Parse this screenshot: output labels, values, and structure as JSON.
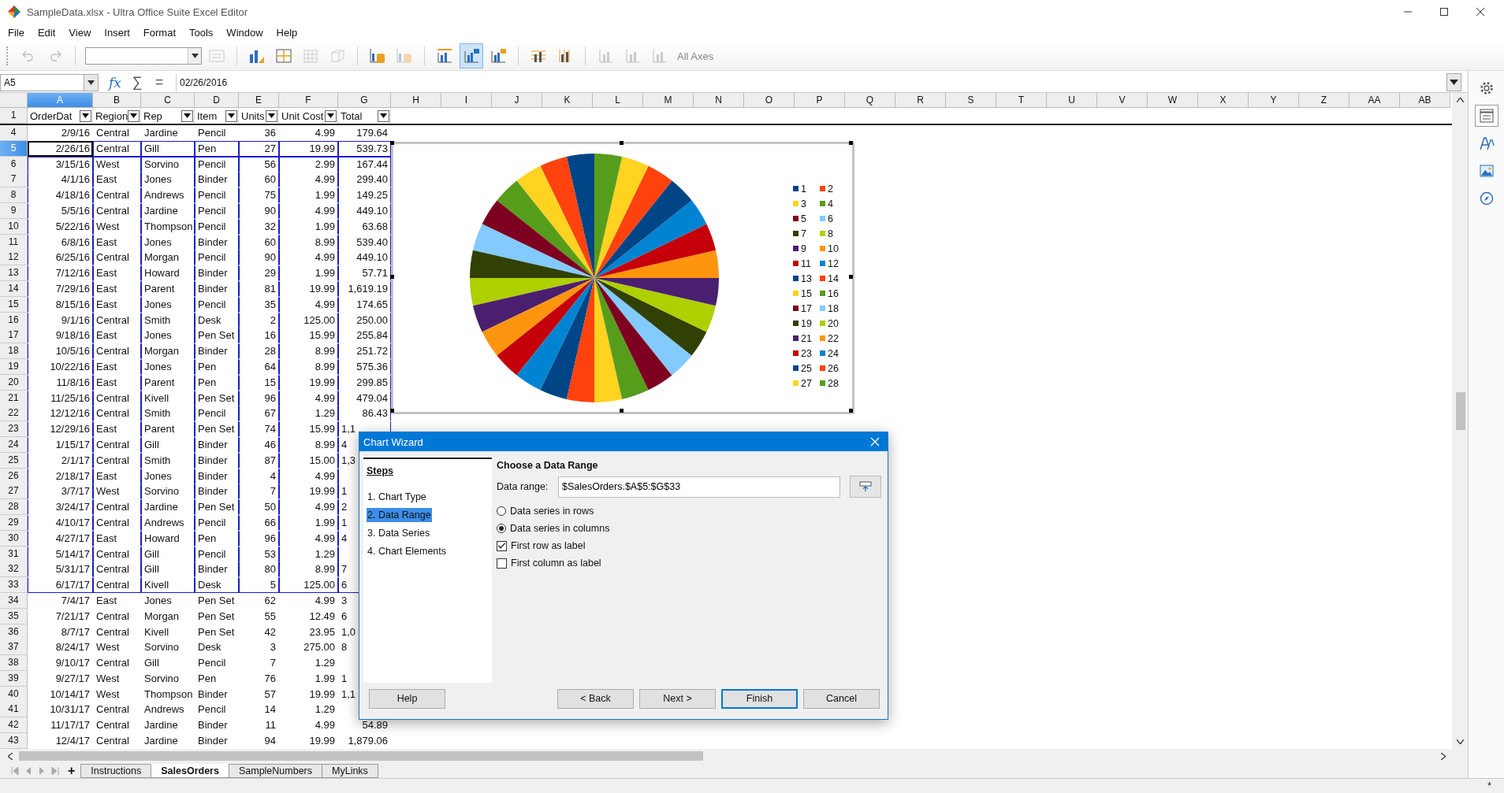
{
  "window": {
    "title": "SampleData.xlsx - Ultra Office Suite Excel Editor"
  },
  "menu": [
    "File",
    "Edit",
    "View",
    "Insert",
    "Format",
    "Tools",
    "Window",
    "Help"
  ],
  "toolbar": {
    "groups": [
      {
        "items": [
          {
            "kind": "undo",
            "disabled": true,
            "selected": false
          },
          {
            "kind": "redo",
            "disabled": true,
            "selected": false
          }
        ]
      },
      {
        "items": [
          {
            "kind": "combo",
            "disabled": false,
            "selected": false
          },
          {
            "kind": "format",
            "disabled": true,
            "selected": false
          }
        ]
      },
      {
        "items": [
          {
            "kind": "chart-type",
            "disabled": false,
            "selected": false
          },
          {
            "kind": "data-table",
            "disabled": false,
            "selected": false
          },
          {
            "kind": "grid",
            "disabled": true,
            "selected": false
          },
          {
            "kind": "cube",
            "disabled": true,
            "selected": false
          }
        ]
      },
      {
        "items": [
          {
            "kind": "data-range",
            "disabled": false,
            "selected": false
          },
          {
            "kind": "data-series",
            "disabled": true,
            "selected": false
          }
        ]
      },
      {
        "items": [
          {
            "kind": "title",
            "disabled": false,
            "selected": false
          },
          {
            "kind": "legend",
            "disabled": false,
            "selected": true
          },
          {
            "kind": "legend-toggle",
            "disabled": false,
            "selected": false
          }
        ]
      },
      {
        "items": [
          {
            "kind": "h-gridlines",
            "disabled": false,
            "selected": false
          },
          {
            "kind": "v-gridlines",
            "disabled": false,
            "selected": false
          }
        ]
      },
      {
        "items": [
          {
            "kind": "axis",
            "disabled": true,
            "selected": false
          },
          {
            "kind": "axis",
            "disabled": true,
            "selected": false
          },
          {
            "kind": "axis",
            "disabled": true,
            "selected": false
          },
          {
            "kind": "label",
            "label": "All Axes",
            "disabled": true,
            "selected": false
          }
        ]
      }
    ]
  },
  "formula_bar": {
    "name_box": "A5",
    "buttons": [
      "fx",
      "∑",
      "="
    ],
    "value": "02/26/2016"
  },
  "columns": [
    {
      "label": "A",
      "selected": true
    },
    {
      "label": "B",
      "selected": false
    },
    {
      "label": "C",
      "selected": false
    },
    {
      "label": "D",
      "selected": false
    },
    {
      "label": "E",
      "selected": false
    },
    {
      "label": "F",
      "selected": false
    },
    {
      "label": "G",
      "selected": false
    },
    {
      "label": "H",
      "selected": false
    },
    {
      "label": "I",
      "selected": false
    },
    {
      "label": "J",
      "selected": false
    },
    {
      "label": "K",
      "selected": false
    },
    {
      "label": "L",
      "selected": false
    },
    {
      "label": "M",
      "selected": false
    },
    {
      "label": "N",
      "selected": false
    },
    {
      "label": "O",
      "selected": false
    },
    {
      "label": "P",
      "selected": false
    },
    {
      "label": "Q",
      "selected": false
    },
    {
      "label": "R",
      "selected": false
    },
    {
      "label": "S",
      "selected": false
    },
    {
      "label": "T",
      "selected": false
    },
    {
      "label": "U",
      "selected": false
    },
    {
      "label": "V",
      "selected": false
    },
    {
      "label": "W",
      "selected": false
    },
    {
      "label": "X",
      "selected": false
    },
    {
      "label": "Y",
      "selected": false
    },
    {
      "label": "Z",
      "selected": false
    },
    {
      "label": "AA",
      "selected": false
    },
    {
      "label": "AB",
      "selected": false
    }
  ],
  "header_row": {
    "number": "1",
    "cells": [
      "OrderDat",
      "Region",
      "Rep",
      "Item",
      "Units",
      "Unit Cost",
      "Total"
    ]
  },
  "rows": [
    {
      "number": "4",
      "selected": false,
      "in_range": false,
      "cells": [
        "2/9/16",
        "Central",
        "Jardine",
        "Pencil",
        "36",
        "4.99",
        "179.64"
      ]
    },
    {
      "number": "5",
      "selected": true,
      "in_range": true,
      "cells": [
        "2/26/16",
        "Central",
        "Gill",
        "Pen",
        "27",
        "19.99",
        "539.73"
      ]
    },
    {
      "number": "6",
      "selected": false,
      "in_range": true,
      "cells": [
        "3/15/16",
        "West",
        "Sorvino",
        "Pencil",
        "56",
        "2.99",
        "167.44"
      ]
    },
    {
      "number": "7",
      "selected": false,
      "in_range": true,
      "cells": [
        "4/1/16",
        "East",
        "Jones",
        "Binder",
        "60",
        "4.99",
        "299.40"
      ]
    },
    {
      "number": "8",
      "selected": false,
      "in_range": true,
      "cells": [
        "4/18/16",
        "Central",
        "Andrews",
        "Pencil",
        "75",
        "1.99",
        "149.25"
      ]
    },
    {
      "number": "9",
      "selected": false,
      "in_range": true,
      "cells": [
        "5/5/16",
        "Central",
        "Jardine",
        "Pencil",
        "90",
        "4.99",
        "449.10"
      ]
    },
    {
      "number": "10",
      "selected": false,
      "in_range": true,
      "cells": [
        "5/22/16",
        "West",
        "Thompson",
        "Pencil",
        "32",
        "1.99",
        "63.68"
      ]
    },
    {
      "number": "11",
      "selected": false,
      "in_range": true,
      "cells": [
        "6/8/16",
        "East",
        "Jones",
        "Binder",
        "60",
        "8.99",
        "539.40"
      ]
    },
    {
      "number": "12",
      "selected": false,
      "in_range": true,
      "cells": [
        "6/25/16",
        "Central",
        "Morgan",
        "Pencil",
        "90",
        "4.99",
        "449.10"
      ]
    },
    {
      "number": "13",
      "selected": false,
      "in_range": true,
      "cells": [
        "7/12/16",
        "East",
        "Howard",
        "Binder",
        "29",
        "1.99",
        "57.71"
      ]
    },
    {
      "number": "14",
      "selected": false,
      "in_range": true,
      "cells": [
        "7/29/16",
        "East",
        "Parent",
        "Binder",
        "81",
        "19.99",
        "1,619.19"
      ]
    },
    {
      "number": "15",
      "selected": false,
      "in_range": true,
      "cells": [
        "8/15/16",
        "East",
        "Jones",
        "Pencil",
        "35",
        "4.99",
        "174.65"
      ]
    },
    {
      "number": "16",
      "selected": false,
      "in_range": true,
      "cells": [
        "9/1/16",
        "Central",
        "Smith",
        "Desk",
        "2",
        "125.00",
        "250.00"
      ]
    },
    {
      "number": "17",
      "selected": false,
      "in_range": true,
      "cells": [
        "9/18/16",
        "East",
        "Jones",
        "Pen Set",
        "16",
        "15.99",
        "255.84"
      ]
    },
    {
      "number": "18",
      "selected": false,
      "in_range": true,
      "cells": [
        "10/5/16",
        "Central",
        "Morgan",
        "Binder",
        "28",
        "8.99",
        "251.72"
      ]
    },
    {
      "number": "19",
      "selected": false,
      "in_range": true,
      "cells": [
        "10/22/16",
        "East",
        "Jones",
        "Pen",
        "64",
        "8.99",
        "575.36"
      ]
    },
    {
      "number": "20",
      "selected": false,
      "in_range": true,
      "cells": [
        "11/8/16",
        "East",
        "Parent",
        "Pen",
        "15",
        "19.99",
        "299.85"
      ]
    },
    {
      "number": "21",
      "selected": false,
      "in_range": true,
      "cells": [
        "11/25/16",
        "Central",
        "Kivell",
        "Pen Set",
        "96",
        "4.99",
        "479.04"
      ]
    },
    {
      "number": "22",
      "selected": false,
      "in_range": true,
      "cells": [
        "12/12/16",
        "Central",
        "Smith",
        "Pencil",
        "67",
        "1.29",
        "86.43"
      ]
    },
    {
      "number": "23",
      "selected": false,
      "in_range": true,
      "cells": [
        "12/29/16",
        "East",
        "Parent",
        "Pen Set",
        "74",
        "15.99",
        "1,1"
      ]
    },
    {
      "number": "24",
      "selected": false,
      "in_range": true,
      "cells": [
        "1/15/17",
        "Central",
        "Gill",
        "Binder",
        "46",
        "8.99",
        "4"
      ]
    },
    {
      "number": "25",
      "selected": false,
      "in_range": true,
      "cells": [
        "2/1/17",
        "Central",
        "Smith",
        "Binder",
        "87",
        "15.00",
        "1,3"
      ]
    },
    {
      "number": "26",
      "selected": false,
      "in_range": true,
      "cells": [
        "2/18/17",
        "East",
        "Jones",
        "Binder",
        "4",
        "4.99"
      ]
    },
    {
      "number": "27",
      "selected": false,
      "in_range": true,
      "cells": [
        "3/7/17",
        "West",
        "Sorvino",
        "Binder",
        "7",
        "19.99",
        "1"
      ]
    },
    {
      "number": "28",
      "selected": false,
      "in_range": true,
      "cells": [
        "3/24/17",
        "Central",
        "Jardine",
        "Pen Set",
        "50",
        "4.99",
        "2"
      ]
    },
    {
      "number": "29",
      "selected": false,
      "in_range": true,
      "cells": [
        "4/10/17",
        "Central",
        "Andrews",
        "Pencil",
        "66",
        "1.99",
        "1"
      ]
    },
    {
      "number": "30",
      "selected": false,
      "in_range": true,
      "cells": [
        "4/27/17",
        "East",
        "Howard",
        "Pen",
        "96",
        "4.99",
        "4"
      ]
    },
    {
      "number": "31",
      "selected": false,
      "in_range": true,
      "cells": [
        "5/14/17",
        "Central",
        "Gill",
        "Pencil",
        "53",
        "1.29"
      ]
    },
    {
      "number": "32",
      "selected": false,
      "in_range": true,
      "cells": [
        "5/31/17",
        "Central",
        "Gill",
        "Binder",
        "80",
        "8.99",
        "7"
      ]
    },
    {
      "number": "33",
      "selected": false,
      "in_range": true,
      "cells": [
        "6/17/17",
        "Central",
        "Kivell",
        "Desk",
        "5",
        "125.00",
        "6"
      ]
    },
    {
      "number": "34",
      "selected": false,
      "in_range": false,
      "cells": [
        "7/4/17",
        "East",
        "Jones",
        "Pen Set",
        "62",
        "4.99",
        "3"
      ]
    },
    {
      "number": "35",
      "selected": false,
      "in_range": false,
      "cells": [
        "7/21/17",
        "Central",
        "Morgan",
        "Pen Set",
        "55",
        "12.49",
        "6"
      ]
    },
    {
      "number": "36",
      "selected": false,
      "in_range": false,
      "cells": [
        "8/7/17",
        "Central",
        "Kivell",
        "Pen Set",
        "42",
        "23.95",
        "1,0"
      ]
    },
    {
      "number": "37",
      "selected": false,
      "in_range": false,
      "cells": [
        "8/24/17",
        "West",
        "Sorvino",
        "Desk",
        "3",
        "275.00",
        "8"
      ]
    },
    {
      "number": "38",
      "selected": false,
      "in_range": false,
      "cells": [
        "9/10/17",
        "Central",
        "Gill",
        "Pencil",
        "7",
        "1.29"
      ]
    },
    {
      "number": "39",
      "selected": false,
      "in_range": false,
      "cells": [
        "9/27/17",
        "West",
        "Sorvino",
        "Pen",
        "76",
        "1.99",
        "1"
      ]
    },
    {
      "number": "40",
      "selected": false,
      "in_range": false,
      "cells": [
        "10/14/17",
        "West",
        "Thompson",
        "Binder",
        "57",
        "19.99",
        "1,1"
      ]
    },
    {
      "number": "41",
      "selected": false,
      "in_range": false,
      "cells": [
        "10/31/17",
        "Central",
        "Andrews",
        "Pencil",
        "14",
        "1.29"
      ]
    },
    {
      "number": "42",
      "selected": false,
      "in_range": false,
      "cells": [
        "11/17/17",
        "Central",
        "Jardine",
        "Binder",
        "11",
        "4.99",
        "54.89"
      ]
    },
    {
      "number": "43",
      "selected": false,
      "in_range": false,
      "cells": [
        "12/4/17",
        "Central",
        "Jardine",
        "Binder",
        "94",
        "19.99",
        "1,879.06"
      ]
    }
  ],
  "chart": {
    "legend": [
      {
        "label": "1",
        "color": "#004586"
      },
      {
        "label": "2",
        "color": "#ff420e"
      },
      {
        "label": "3",
        "color": "#ffd320"
      },
      {
        "label": "4",
        "color": "#579d1c"
      },
      {
        "label": "5",
        "color": "#7e0021"
      },
      {
        "label": "6",
        "color": "#83caff"
      },
      {
        "label": "7",
        "color": "#314004"
      },
      {
        "label": "8",
        "color": "#aecf00"
      },
      {
        "label": "9",
        "color": "#4b1f6f"
      },
      {
        "label": "10",
        "color": "#ff950e"
      },
      {
        "label": "11",
        "color": "#c5000b"
      },
      {
        "label": "12",
        "color": "#0084d1"
      },
      {
        "label": "13",
        "color": "#004586"
      },
      {
        "label": "14",
        "color": "#ff420e"
      },
      {
        "label": "15",
        "color": "#ffd320"
      },
      {
        "label": "16",
        "color": "#579d1c"
      },
      {
        "label": "17",
        "color": "#7e0021"
      },
      {
        "label": "18",
        "color": "#83caff"
      },
      {
        "label": "19",
        "color": "#314004"
      },
      {
        "label": "20",
        "color": "#aecf00"
      },
      {
        "label": "21",
        "color": "#4b1f6f"
      },
      {
        "label": "22",
        "color": "#ff950e"
      },
      {
        "label": "23",
        "color": "#c5000b"
      },
      {
        "label": "24",
        "color": "#0084d1"
      },
      {
        "label": "25",
        "color": "#004586"
      },
      {
        "label": "26",
        "color": "#ff420e"
      },
      {
        "label": "27",
        "color": "#ffd320"
      },
      {
        "label": "28",
        "color": "#579d1c"
      }
    ]
  },
  "sidebar": [
    {
      "kind": "settings",
      "selected": false
    },
    {
      "kind": "properties",
      "selected": true
    },
    {
      "kind": "styles",
      "selected": false
    },
    {
      "kind": "gallery",
      "selected": false
    },
    {
      "kind": "navigator",
      "selected": false
    }
  ],
  "sheet_tabs": {
    "add": "+",
    "tabs": [
      {
        "label": "Instructions",
        "selected": false
      },
      {
        "label": "SalesOrders",
        "selected": true
      },
      {
        "label": "SampleNumbers",
        "selected": false
      },
      {
        "label": "MyLinks",
        "selected": false
      }
    ]
  },
  "status_bar": {
    "modified": "*"
  },
  "dialog": {
    "title": "Chart Wizard",
    "steps_heading": "Steps",
    "steps": [
      {
        "label": "1. Chart Type",
        "selected": false
      },
      {
        "label": "2. Data Range",
        "selected": true
      },
      {
        "label": "3. Data Series",
        "selected": false
      },
      {
        "label": "4. Chart Elements",
        "selected": false
      }
    ],
    "heading": "Choose a Data Range",
    "field_label": "Data range:",
    "field_value": "$SalesOrders.$A$5:$G$33",
    "series_in": [
      {
        "label": "Data series in rows",
        "selected": false
      },
      {
        "label": "Data series in columns",
        "selected": true
      }
    ],
    "label_options": [
      {
        "label": "First row as label",
        "checked": true
      },
      {
        "label": "First column as label",
        "checked": false
      }
    ],
    "help": "Help",
    "buttons": [
      {
        "label": "< Back",
        "default": false
      },
      {
        "label": "Next >",
        "default": false
      },
      {
        "label": "Finish",
        "default": true
      },
      {
        "label": "Cancel",
        "default": false
      }
    ]
  }
}
